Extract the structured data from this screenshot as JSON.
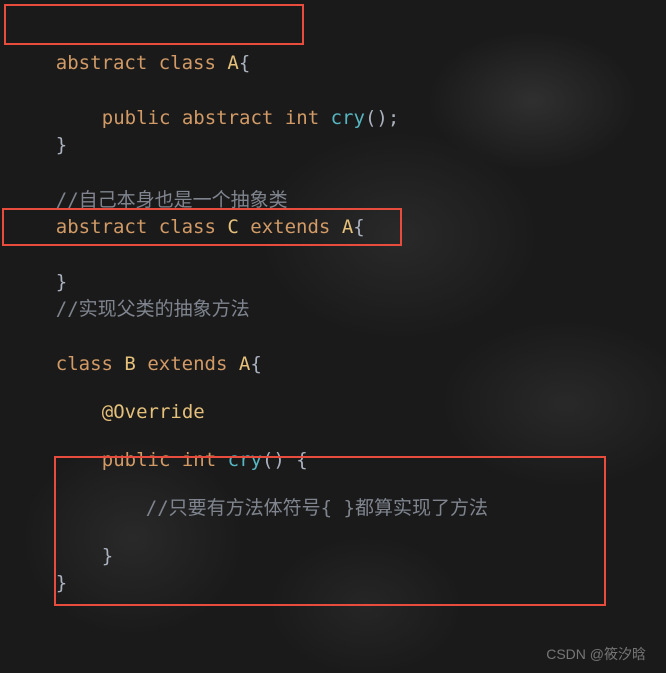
{
  "code": {
    "line1": {
      "kw1": "abstract",
      "kw2": "class",
      "name": "A",
      "brace": "{"
    },
    "line2": {
      "kw1": "public",
      "kw2": "abstract",
      "kw3": "int",
      "method": "cry",
      "rest": "();"
    },
    "line3": {
      "brace": "}"
    },
    "line4": {
      "comment": "//自己本身也是一个抽象类"
    },
    "line5": {
      "kw1": "abstract",
      "kw2": "class",
      "name": "C",
      "kw3": "extends",
      "parent": "A",
      "brace": "{"
    },
    "line6": {
      "brace": "}"
    },
    "line7": {
      "comment": "//实现父类的抽象方法"
    },
    "line8": {
      "kw1": "class",
      "name": "B",
      "kw2": "extends",
      "parent": "A",
      "brace": "{"
    },
    "line9": {
      "annotation": "@Override"
    },
    "line10": {
      "kw1": "public",
      "kw2": "int",
      "method": "cry",
      "parens": "()",
      "brace": " {"
    },
    "line11": {
      "comment": "//只要有方法体符号{ }都算实现了方法"
    },
    "line12": {
      "brace": "}"
    },
    "line13": {
      "brace": "}"
    }
  },
  "watermark": "CSDN @筱汐晗"
}
